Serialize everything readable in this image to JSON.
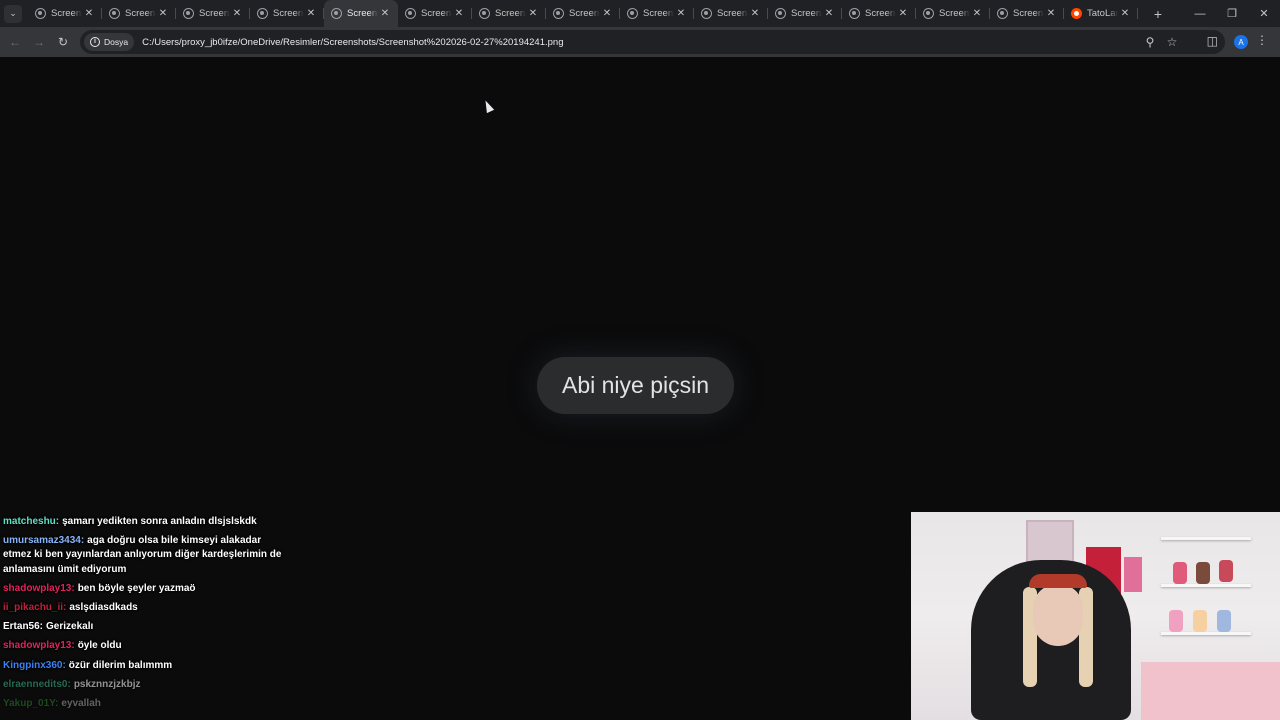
{
  "browser": {
    "tabs": [
      {
        "title": "Screenshot",
        "active": false,
        "favicon": "globe-icon"
      },
      {
        "title": "Screenshot",
        "active": false,
        "favicon": "globe-icon"
      },
      {
        "title": "Screenshot",
        "active": false,
        "favicon": "globe-icon"
      },
      {
        "title": "Screenshot",
        "active": false,
        "favicon": "globe-icon"
      },
      {
        "title": "Screenshot",
        "active": true,
        "favicon": "globe-icon"
      },
      {
        "title": "Screenshot",
        "active": false,
        "favicon": "globe-icon"
      },
      {
        "title": "Screenshot",
        "active": false,
        "favicon": "globe-icon"
      },
      {
        "title": "Screenshot",
        "active": false,
        "favicon": "globe-icon"
      },
      {
        "title": "Screenshot",
        "active": false,
        "favicon": "globe-icon"
      },
      {
        "title": "Screenshot",
        "active": false,
        "favicon": "globe-icon"
      },
      {
        "title": "Screenshot",
        "active": false,
        "favicon": "globe-icon"
      },
      {
        "title": "Screenshot",
        "active": false,
        "favicon": "globe-icon"
      },
      {
        "title": "Screenshot",
        "active": false,
        "favicon": "globe-icon"
      },
      {
        "title": "Screenshot",
        "active": false,
        "favicon": "globe-icon"
      },
      {
        "title": "TatoLand",
        "active": false,
        "favicon": "reddit-icon"
      }
    ],
    "new_tab_label": "+",
    "address": {
      "chip_label": "Dosya",
      "url": "C:/Users/proxy_jb0ifze/OneDrive/Resimler/Screenshots/Screenshot%202026-02-27%20194241.png"
    },
    "profile_initial": "A"
  },
  "page": {
    "bubble_text": "Abi niye piçsin"
  },
  "chat": {
    "messages": [
      {
        "user": "matcheshu:",
        "user_color": "#5fe0c5",
        "text": "şamarı yedikten sonra anladın dlsjslskdk"
      },
      {
        "user": "umursamaz3434:",
        "user_color": "#8ab4f8",
        "text": "aga doğru olsa bile kimseyi alakadar etmez ki ben yayınlardan anlıyorum diğer kardeşlerimin de anlamasını ümit ediyorum"
      },
      {
        "user": "shadowplay13:",
        "user_color": "#e0245e",
        "text": "ben böyle şeyler yazmaö"
      },
      {
        "user": "ii_pikachu_ii:",
        "user_color": "#c0203a",
        "text": "aslşdiasdkads"
      },
      {
        "user": "Ertan56:",
        "user_color": "#ffffff",
        "text": "Gerizekalı"
      },
      {
        "user": "shadowplay13:",
        "user_color": "#e0245e",
        "text": "öyle oldu"
      },
      {
        "user": "Kingpinx360:",
        "user_color": "#3b82f6",
        "text": "özür dilerim balımmm"
      },
      {
        "user": "elraennedits0:",
        "user_color": "#3fb58a",
        "text": "pskznnzjzkbjz"
      },
      {
        "user": "Yakup_01Y:",
        "user_color": "#3fbf3f",
        "text": "eyvallah"
      }
    ]
  }
}
